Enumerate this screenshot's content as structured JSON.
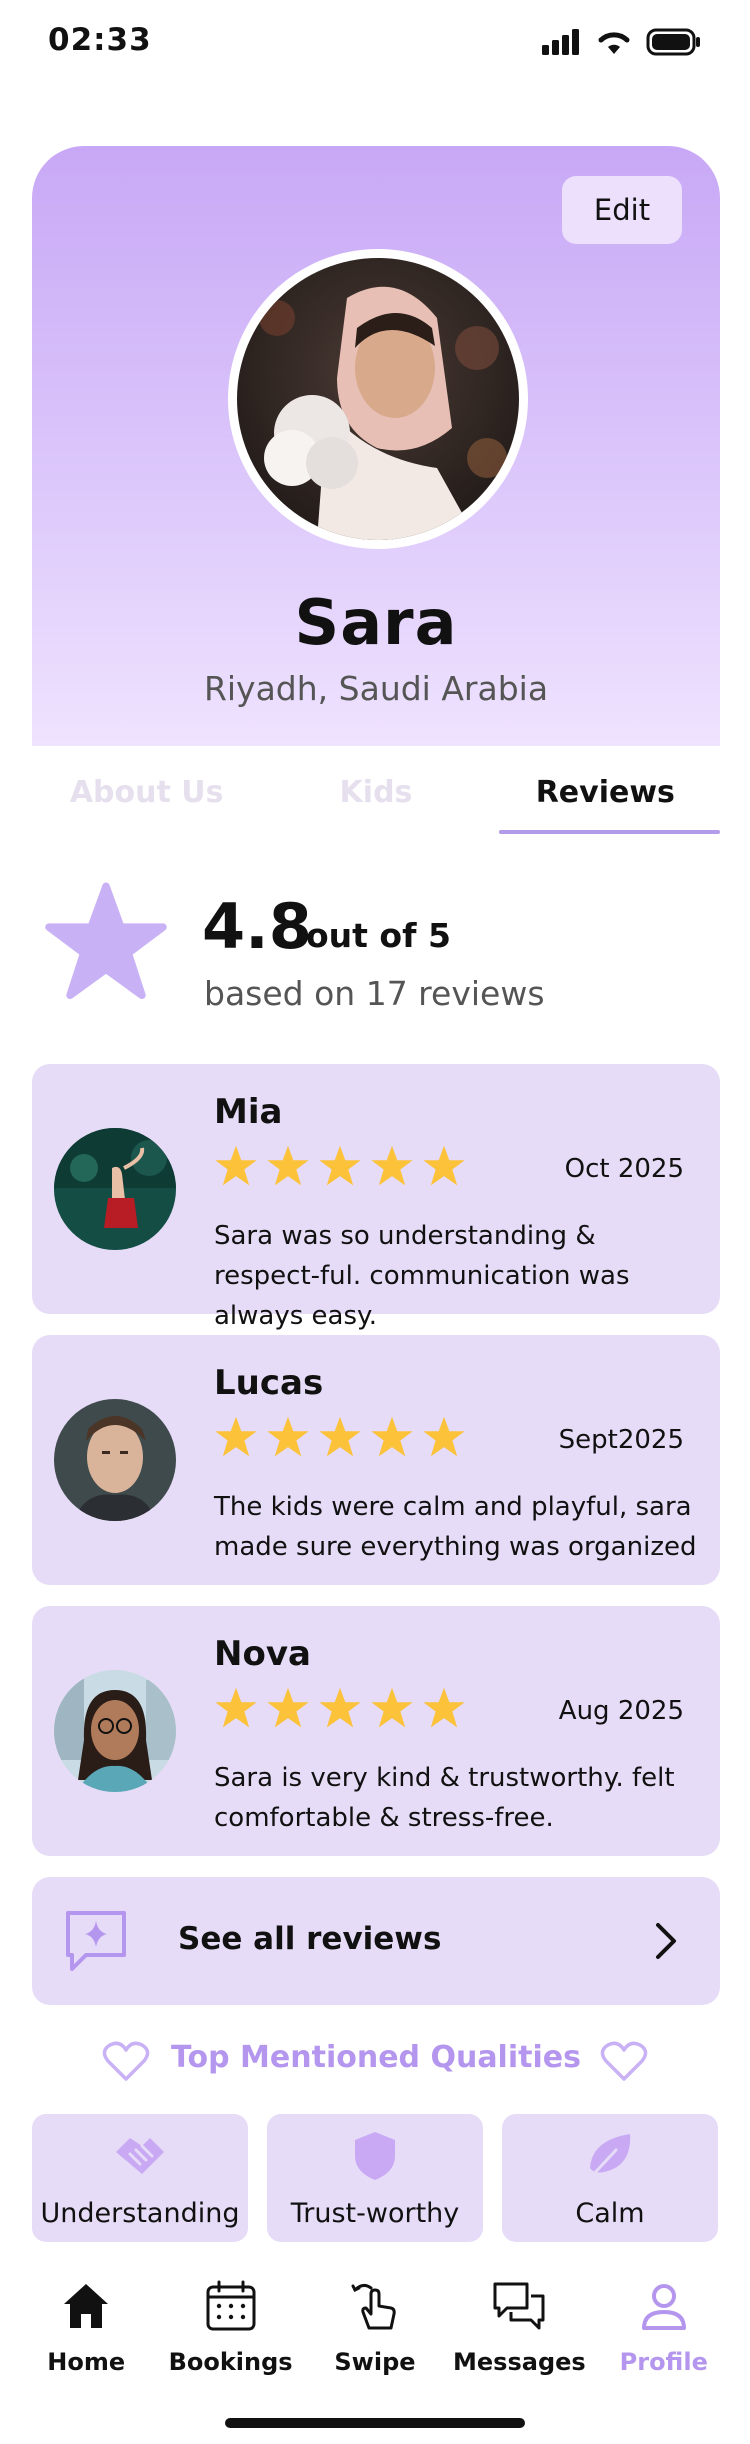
{
  "status_bar": {
    "time": "02:33"
  },
  "profile": {
    "edit_label": "Edit",
    "name": "Sara",
    "location": "Riyadh, Saudi Arabia"
  },
  "tabs": [
    {
      "label": "About Us",
      "active": false
    },
    {
      "label": "Kids",
      "active": false
    },
    {
      "label": "Reviews",
      "active": true
    }
  ],
  "rating": {
    "value": "4.8",
    "out_of": "out of 5",
    "based_on": "based on 17 reviews"
  },
  "reviews": [
    {
      "name": "Mia",
      "stars": 5,
      "date": "Oct 2025",
      "text": "Sara was so understanding & respect-ful. communication was always easy."
    },
    {
      "name": "Lucas",
      "stars": 5,
      "date": "Sept2025",
      "text": " The kids were calm and playful, sara made sure everything was organized"
    },
    {
      "name": "Nova",
      "stars": 5,
      "date": "Aug 2025",
      "text": "Sara is very kind & trustworthy. felt comfortable & stress-free."
    }
  ],
  "see_all": {
    "label": "See all reviews"
  },
  "qualities": {
    "title": "Top Mentioned Qualities",
    "items": [
      {
        "label": "Understanding",
        "icon": "handshake-icon"
      },
      {
        "label": "Trust-worthy",
        "icon": "shield-icon"
      },
      {
        "label": "Calm",
        "icon": "leaf-icon"
      }
    ]
  },
  "nav": [
    {
      "label": "Home",
      "icon": "home-icon",
      "active": false
    },
    {
      "label": "Bookings",
      "icon": "calendar-icon",
      "active": false
    },
    {
      "label": "Swipe",
      "icon": "swipe-hand-icon",
      "active": false
    },
    {
      "label": "Messages",
      "icon": "chat-bubbles-icon",
      "active": false
    },
    {
      "label": "Profile",
      "icon": "person-icon",
      "active": true
    }
  ],
  "colors": {
    "accent": "#b496ee",
    "card_bg": "#e6dcf7",
    "star": "#fbc23a"
  }
}
